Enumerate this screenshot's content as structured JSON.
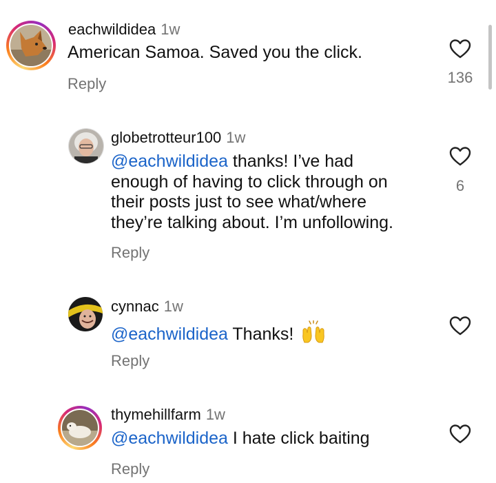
{
  "comments": [
    {
      "username": "eachwildidea",
      "time": "1w",
      "text": "American Samoa. Saved you the click.",
      "reply_label": "Reply",
      "likes": "136"
    },
    {
      "username": "globetrotteur100",
      "time": "1w",
      "mention": "@eachwildidea",
      "text_line1": " thanks! I’ve had",
      "text_line2": "enough of having to click through on",
      "text_line3": "their posts just to see what/where",
      "text_line4": "they’re talking about. I’m unfollowing.",
      "reply_label": "Reply",
      "likes": "6"
    },
    {
      "username": "cynnac",
      "time": "1w",
      "mention": "@eachwildidea",
      "text": " Thanks! ",
      "emoji": "raising-hands-emoji",
      "reply_label": "Reply"
    },
    {
      "username": "thymehillfarm",
      "time": "1w",
      "mention": "@eachwildidea",
      "text": " I hate click baiting",
      "reply_label": "Reply"
    }
  ],
  "icons": {
    "like": "heart-outline-icon",
    "story_ring": "story-ring-gradient"
  },
  "colors": {
    "mention": "#1b64c9",
    "secondary_text": "#737373"
  }
}
